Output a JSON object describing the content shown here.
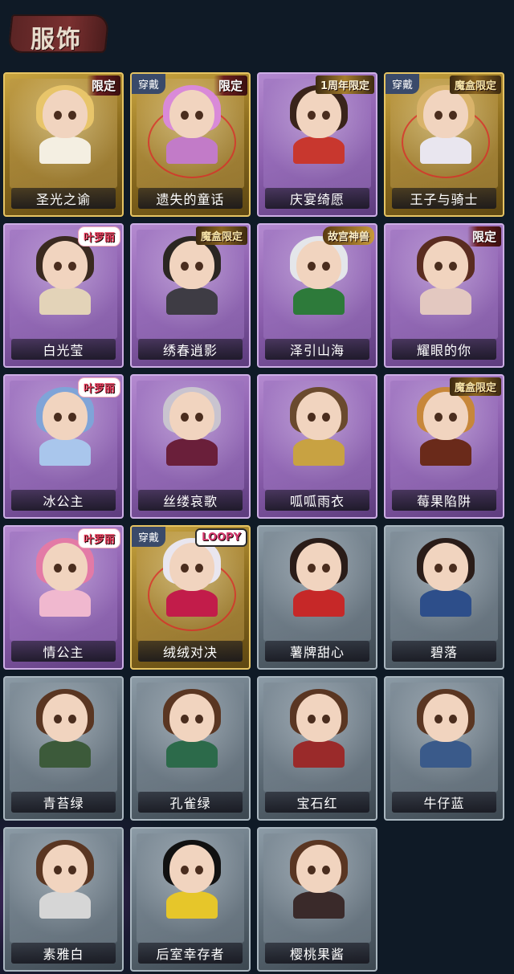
{
  "header": {
    "title": "服饰"
  },
  "cards": [
    {
      "name": "圣光之谕",
      "style": "gold",
      "badge": "限定",
      "badge_type": "limited",
      "equipped": false,
      "hair": "#e8c56a",
      "outfit": "#f4efe2"
    },
    {
      "name": "遗失的童话",
      "style": "gold",
      "badge": "限定",
      "badge_type": "limited",
      "equipped": true,
      "equip_label": "穿戴",
      "hair": "#d98ad8",
      "outfit": "#c27bc8"
    },
    {
      "name": "庆宴绮愿",
      "style": "purple",
      "badge": "1周年限定",
      "badge_type": "anniv",
      "equipped": false,
      "hair": "#3a241a",
      "outfit": "#c8372e"
    },
    {
      "name": "王子与骑士",
      "style": "gold",
      "badge": "魔盒限定",
      "badge_type": "magic",
      "equipped": true,
      "equip_label": "穿戴",
      "hair": "#d9b36a",
      "outfit": "#e9e6ef"
    },
    {
      "name": "白光莹",
      "style": "purple",
      "badge": "叶罗丽",
      "badge_type": "lolita",
      "equipped": false,
      "hair": "#3a2a20",
      "outfit": "#e3d3b8"
    },
    {
      "name": "绣春逍影",
      "style": "purple",
      "badge": "魔盒限定",
      "badge_type": "magic",
      "equipped": false,
      "hair": "#2b2622",
      "outfit": "#3e3c44"
    },
    {
      "name": "泽引山海",
      "style": "purple",
      "badge": "故宫神兽",
      "badge_type": "gugong",
      "equipped": false,
      "hair": "#e4e6ea",
      "outfit": "#2d7a3a"
    },
    {
      "name": "耀眼的你",
      "style": "purple",
      "badge": "限定",
      "badge_type": "limited",
      "equipped": false,
      "hair": "#5a2c20",
      "outfit": "#e3c8c0"
    },
    {
      "name": "冰公主",
      "style": "purple",
      "badge": "叶罗丽",
      "badge_type": "lolita",
      "equipped": false,
      "hair": "#7fa4d8",
      "outfit": "#a9c6ec"
    },
    {
      "name": "丝缕哀歌",
      "style": "purple",
      "badge": "",
      "badge_type": "",
      "equipped": false,
      "hair": "#c9c4cf",
      "outfit": "#6a1f3a"
    },
    {
      "name": "呱呱雨衣",
      "style": "purple",
      "badge": "",
      "badge_type": "",
      "equipped": false,
      "hair": "#6a4a2e",
      "outfit": "#c8a242"
    },
    {
      "name": "莓果陷阱",
      "style": "purple",
      "badge": "魔盒限定",
      "badge_type": "magic",
      "equipped": false,
      "hair": "#c7873a",
      "outfit": "#6a2a1a"
    },
    {
      "name": "情公主",
      "style": "purple",
      "badge": "叶罗丽",
      "badge_type": "lolita",
      "equipped": false,
      "hair": "#e37aa6",
      "outfit": "#f0b8cf"
    },
    {
      "name": "绒绒对决",
      "style": "gold",
      "badge": "LOOPY",
      "badge_type": "loop",
      "equipped": true,
      "equip_label": "穿戴",
      "hair": "#e9e6ef",
      "outfit": "#c21c4a"
    },
    {
      "name": "薯牌甜心",
      "style": "gray",
      "badge": "",
      "badge_type": "",
      "equipped": false,
      "hair": "#2a1c18",
      "outfit": "#c62828"
    },
    {
      "name": "碧落",
      "style": "gray",
      "badge": "",
      "badge_type": "",
      "equipped": false,
      "hair": "#2a1c18",
      "outfit": "#2d4e8a"
    },
    {
      "name": "青苔绿",
      "style": "gray",
      "badge": "",
      "badge_type": "",
      "equipped": false,
      "hair": "#5a3622",
      "outfit": "#3c5a3a"
    },
    {
      "name": "孔雀绿",
      "style": "gray",
      "badge": "",
      "badge_type": "",
      "equipped": false,
      "hair": "#5a3622",
      "outfit": "#2c6a4a"
    },
    {
      "name": "宝石红",
      "style": "gray",
      "badge": "",
      "badge_type": "",
      "equipped": false,
      "hair": "#5a3622",
      "outfit": "#9a2a2a"
    },
    {
      "name": "牛仔蓝",
      "style": "gray",
      "badge": "",
      "badge_type": "",
      "equipped": false,
      "hair": "#5a3622",
      "outfit": "#3a5a8a"
    },
    {
      "name": "素雅白",
      "style": "gray",
      "badge": "",
      "badge_type": "",
      "equipped": false,
      "hair": "#5a3622",
      "outfit": "#d6d6d6"
    },
    {
      "name": "后室幸存者",
      "style": "gray",
      "badge": "",
      "badge_type": "",
      "equipped": false,
      "hair": "#111111",
      "outfit": "#e6c62a"
    },
    {
      "name": "樱桃果酱",
      "style": "gray",
      "badge": "",
      "badge_type": "",
      "equipped": false,
      "hair": "#5a3622",
      "outfit": "#3a2a2a"
    }
  ]
}
